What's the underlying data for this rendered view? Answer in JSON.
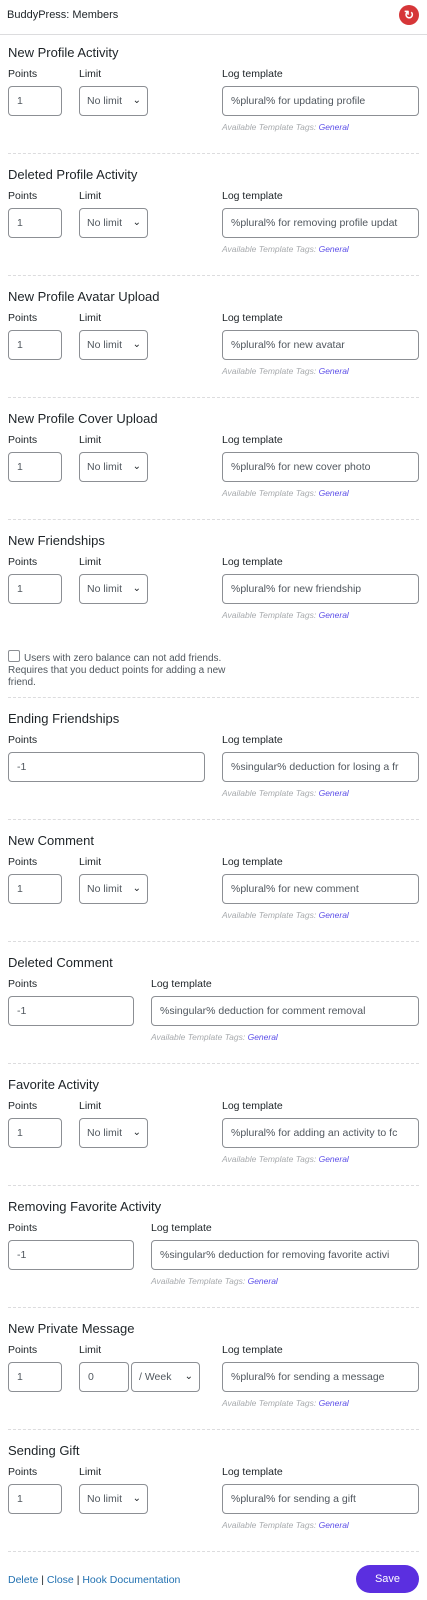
{
  "header": {
    "title": "BuddyPress: Members",
    "icon": "refresh-arrow-icon"
  },
  "labels": {
    "points": "Points",
    "limit": "Limit",
    "log_template": "Log template",
    "tags_prefix": "Available Template Tags:",
    "tags_link": "General"
  },
  "sections": [
    {
      "title": "New Profile Activity",
      "points": "1",
      "limit": "No limit",
      "log": "%plural% for updating profile"
    },
    {
      "title": "Deleted Profile Activity",
      "points": "1",
      "limit": "No limit",
      "log": "%plural% for removing profile updat"
    },
    {
      "title": "New Profile Avatar Upload",
      "points": "1",
      "limit": "No limit",
      "log": "%plural% for new avatar"
    },
    {
      "title": "New Profile Cover Upload",
      "points": "1",
      "limit": "No limit",
      "log": "%plural% for new cover photo"
    },
    {
      "title": "New Friendships",
      "points": "1",
      "limit": "No limit",
      "log": "%plural% for new friendship",
      "checkbox": "Users with zero balance can not add friends. Requires that you deduct points for adding a new friend."
    },
    {
      "title": "Ending Friendships",
      "points": "-1",
      "log": "%singular% deduction for losing a fr"
    },
    {
      "title": "New Comment",
      "points": "1",
      "limit": "No limit",
      "log": "%plural% for new comment"
    },
    {
      "title": "Deleted Comment",
      "points": "-1",
      "log": "%singular% deduction for comment removal"
    },
    {
      "title": "Favorite Activity",
      "points": "1",
      "limit": "No limit",
      "log": "%plural% for adding an activity to fc"
    },
    {
      "title": "Removing Favorite Activity",
      "points": "-1",
      "log": "%singular% deduction for removing favorite activi"
    },
    {
      "title": "New Private Message",
      "points": "1",
      "limit_value": "0",
      "limit_period": "/ Week",
      "log": "%plural% for sending a message"
    },
    {
      "title": "Sending Gift",
      "points": "1",
      "limit": "No limit",
      "log": "%plural% for sending a gift"
    }
  ],
  "footer": {
    "delete": "Delete",
    "sep": " | ",
    "close": "Close",
    "docs": "Hook Documentation",
    "save": "Save"
  }
}
